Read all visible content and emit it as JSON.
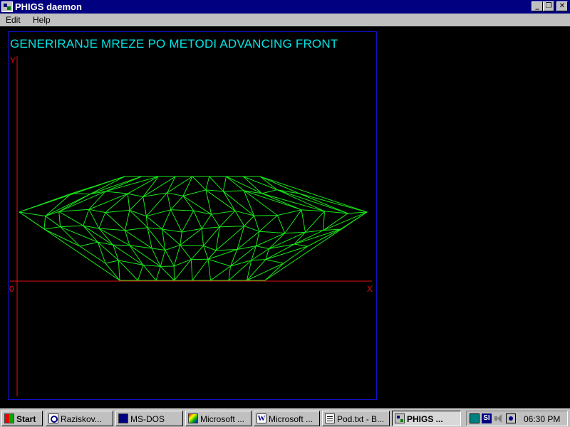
{
  "window": {
    "title": "PHIGS daemon",
    "controls": {
      "minimize": "_",
      "maximize": "❐",
      "close": "✕"
    }
  },
  "menu": {
    "edit": "Edit",
    "help": "Help"
  },
  "plot": {
    "title": "GENERIRANJE MREZE PO METODI ADVANCING FRONT",
    "y_label": "Y",
    "x_label": "X",
    "origin_label": "0",
    "colors": {
      "title": "#00e6e6",
      "axes": "#e01010",
      "mesh": "#19e619",
      "frame": "#1010c8"
    }
  },
  "taskbar": {
    "start": "Start",
    "items": [
      {
        "label": "Raziskov...",
        "icon": "explorer-icon"
      },
      {
        "label": "MS-DOS",
        "icon": "msdos-icon"
      },
      {
        "label": "Microsoft ...",
        "icon": "office-icon"
      },
      {
        "label": "Microsoft ...",
        "icon": "word-icon",
        "glyph": "W"
      },
      {
        "label": "Pod.txt - B...",
        "icon": "notepad-icon"
      },
      {
        "label": "PHIGS ...",
        "icon": "phigs-icon",
        "active": true
      }
    ],
    "tray": {
      "language": "SI",
      "clock": "06:30 PM"
    }
  }
}
